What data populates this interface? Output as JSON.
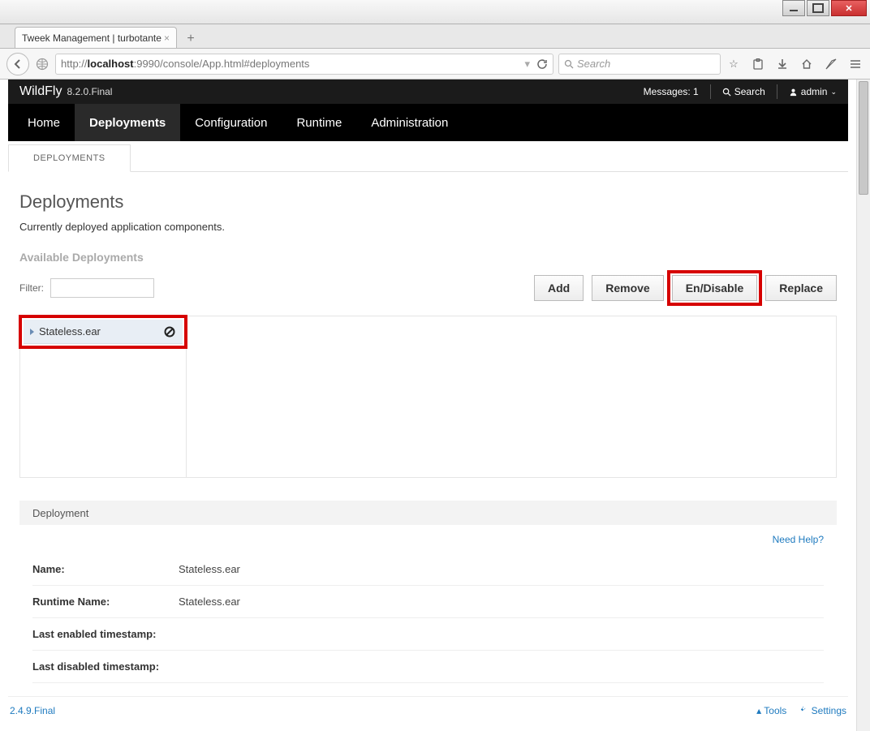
{
  "browser": {
    "tab_title": "Tweek Management | turbotante",
    "url_pre": "http://",
    "url_host": "localhost",
    "url_rest": ":9990/console/App.html#deployments",
    "search_placeholder": "Search"
  },
  "header": {
    "brand": "WildFly",
    "version": "8.2.0.Final",
    "messages_label": "Messages:",
    "messages_count": "1",
    "search_label": "Search",
    "user": "admin"
  },
  "nav": {
    "items": [
      {
        "label": "Home"
      },
      {
        "label": "Deployments"
      },
      {
        "label": "Configuration"
      },
      {
        "label": "Runtime"
      },
      {
        "label": "Administration"
      }
    ]
  },
  "subtab_label": "DEPLOYMENTS",
  "page": {
    "title": "Deployments",
    "desc": "Currently deployed application components.",
    "section": "Available Deployments",
    "filter_label": "Filter:",
    "buttons": {
      "add": "Add",
      "remove": "Remove",
      "endisable": "En/Disable",
      "replace": "Replace"
    },
    "tree_item": "Stateless.ear",
    "crumb": "Deployment",
    "help": "Need Help?",
    "props": [
      {
        "k": "Name:",
        "v": "Stateless.ear"
      },
      {
        "k": "Runtime Name:",
        "v": "Stateless.ear"
      },
      {
        "k": "Last enabled timestamp:",
        "v": ""
      },
      {
        "k": "Last disabled timestamp:",
        "v": ""
      }
    ]
  },
  "footer": {
    "version": "2.4.9.Final",
    "tools": "Tools",
    "settings": "Settings"
  }
}
